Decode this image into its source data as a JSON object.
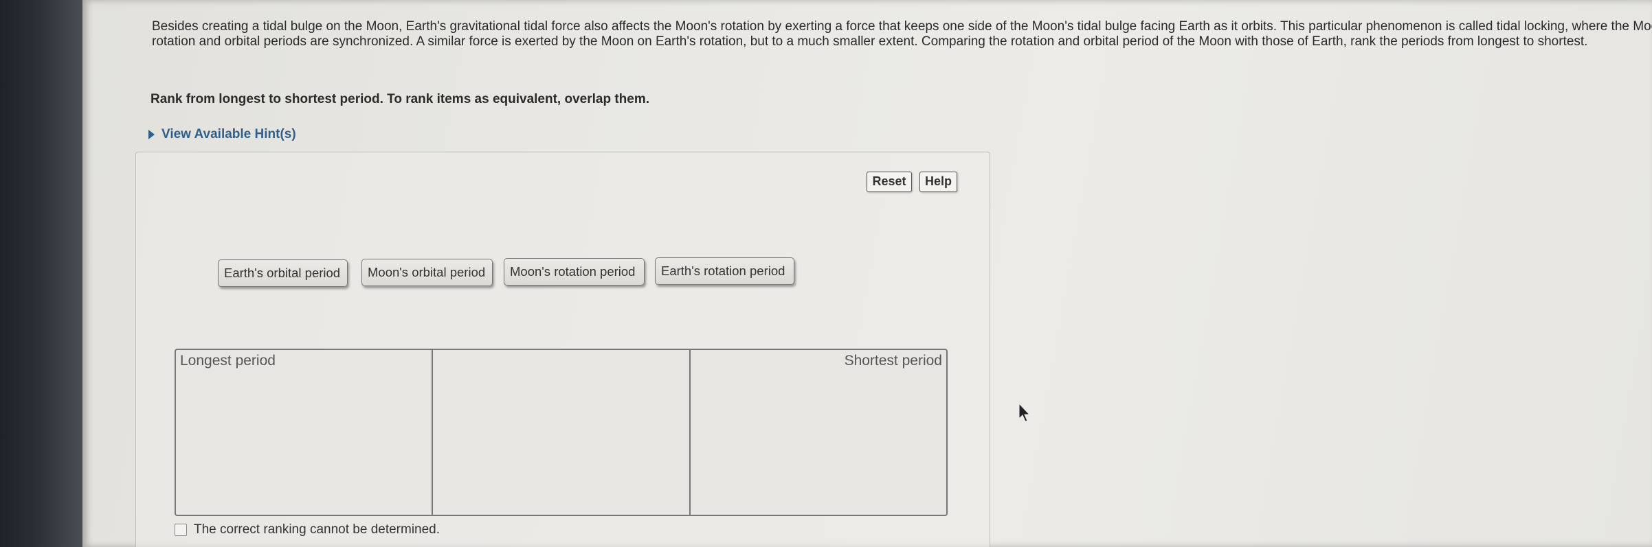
{
  "problem": {
    "text": "Besides creating a tidal bulge on the Moon, Earth's gravitational tidal force also affects the Moon's rotation by exerting a force that keeps one side of the Moon's tidal bulge facing Earth as it orbits. This particular phenomenon is called tidal locking, where the Moon's rotation and orbital periods are synchronized. A similar force is exerted by the Moon on Earth's rotation, but to a much smaller extent. Comparing the rotation and orbital period of the Moon with those of Earth, rank the periods from longest to shortest.",
    "instruction": "Rank from longest to shortest period. To rank items as equivalent, overlap them."
  },
  "hint": {
    "label": "View Available Hint(s)"
  },
  "toolbar": {
    "reset_label": "Reset",
    "help_label": "Help"
  },
  "items": [
    "Earth's orbital period",
    "Moon's orbital period",
    "Moon's rotation period",
    "Earth's rotation period"
  ],
  "ranking": {
    "left_label": "Longest period",
    "right_label": "Shortest period"
  },
  "cannot_determine": {
    "label": "The correct ranking cannot be determined.",
    "checked": false
  },
  "colors": {
    "hint_link": "#2f5f8a",
    "page_bg": "#e8e7e3"
  }
}
